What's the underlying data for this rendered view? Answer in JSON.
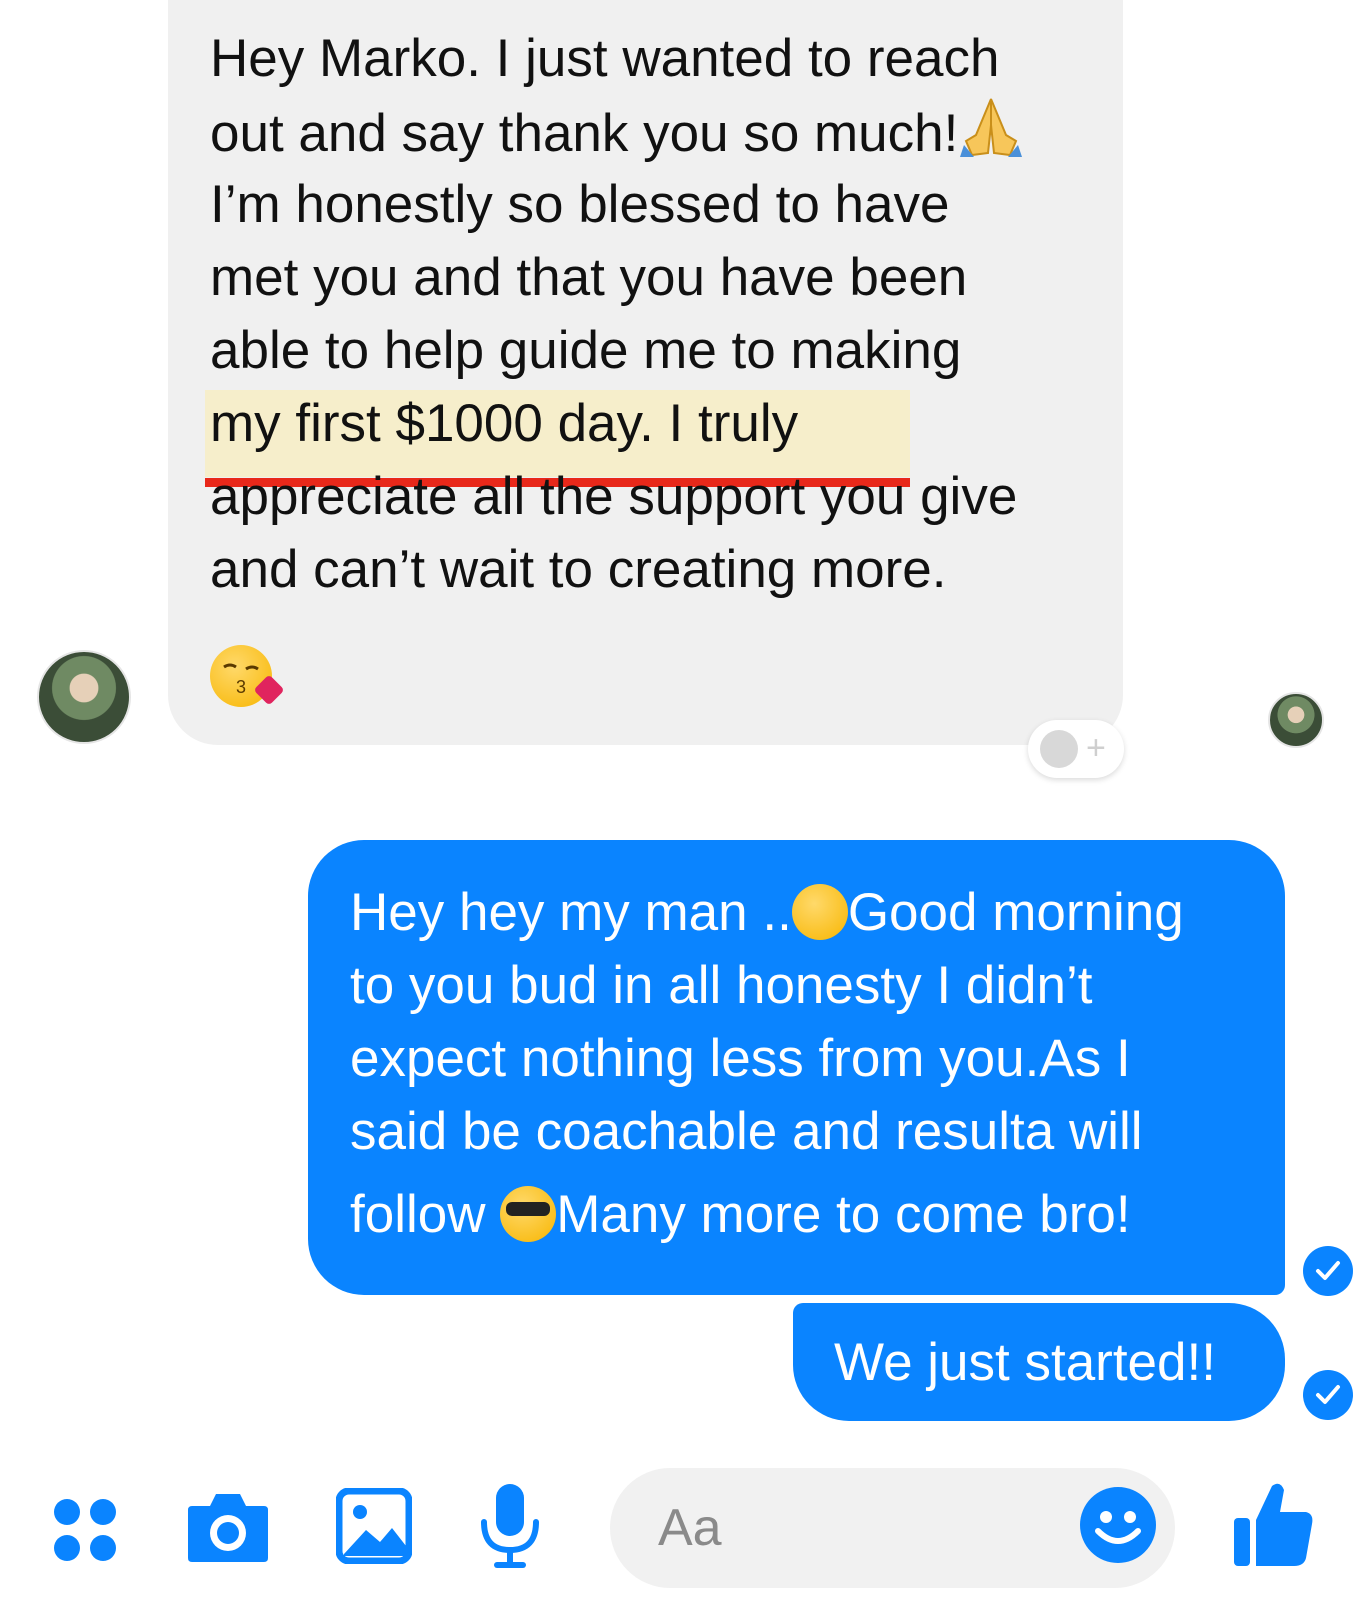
{
  "conversation": {
    "incoming": {
      "lines": [
        "Hey Marko. I just wanted to reach",
        "out and say thank you so much!",
        "I’m honestly so blessed to have",
        "met you and that you have been",
        "able to help guide me to making",
        "my first $1000 day. I truly",
        "appreciate all the support you give",
        "and can’t wait to creating more."
      ],
      "emojis": [
        "folded-hands",
        "kissing-heart"
      ]
    },
    "outgoing": [
      {
        "line1_a": "Hey hey my man ..",
        "line1_b": "Good morning",
        "line2": "to you bud in all honesty I didn’t",
        "line3": "expect nothing less from you.As I",
        "line4": "said be coachable and resulta will",
        "line5_a": "follow ",
        "line5_b": "Many more to come bro!"
      },
      {
        "text": "We just started!!"
      }
    ]
  },
  "composer": {
    "placeholder": "Aa"
  },
  "colors": {
    "accent": "#0a84ff",
    "incoming_bubble": "#f0f0f0",
    "highlight": "#f6eecb",
    "underline": "#e8281a"
  },
  "icons": [
    "apps-icon",
    "camera-icon",
    "image-icon",
    "microphone-icon",
    "emoji-icon",
    "like-icon",
    "add-reaction-icon",
    "read-receipt-icon"
  ]
}
